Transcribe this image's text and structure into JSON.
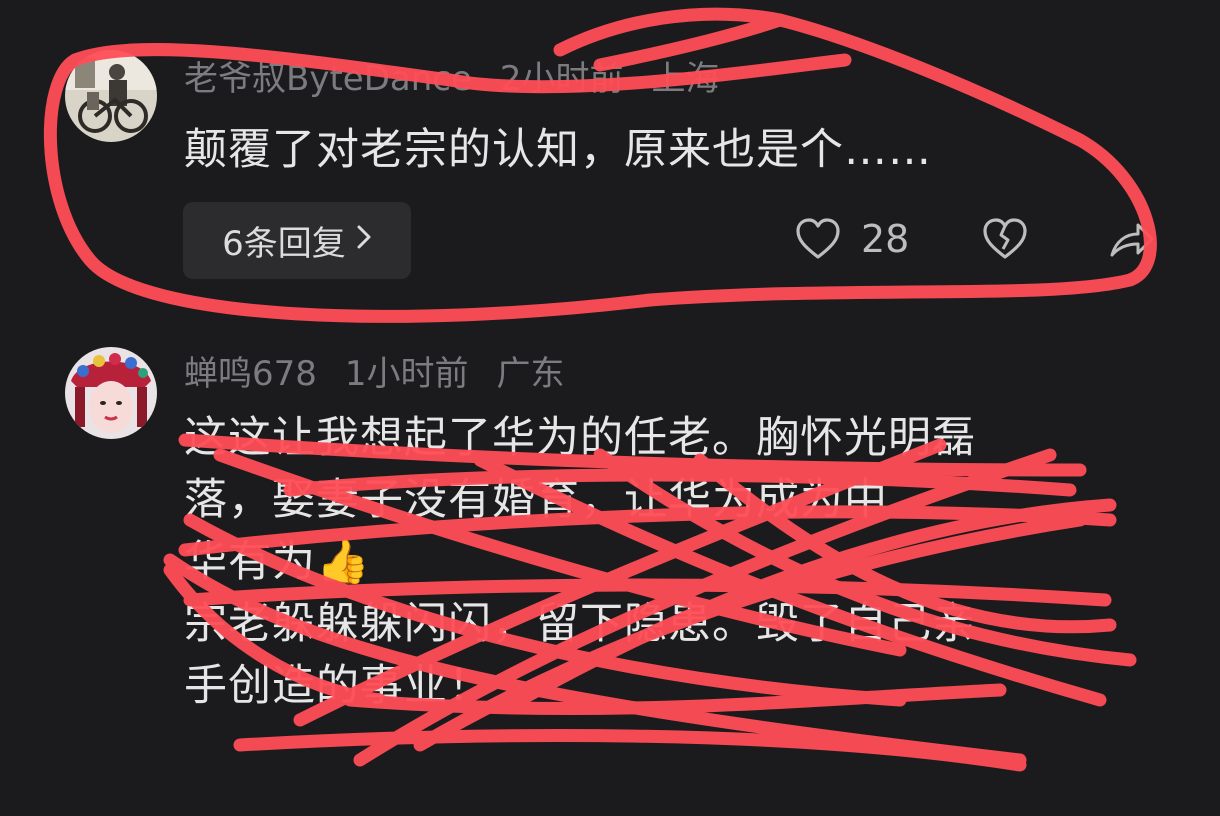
{
  "comments": [
    {
      "username": "老爷叔ByteDance",
      "time": "2小时前",
      "location": "上海",
      "text_lines": [
        "颠覆了对老宗的认知，原来也是个……"
      ],
      "reply_label": "6条回复",
      "like_count": "28"
    },
    {
      "username": "蝉鸣678",
      "time": "1小时前",
      "location": "广东",
      "text_lines": [
        "这这让我想起了华为的任老。胸怀光明磊",
        "落，娶妻子没有婚育，让华为成为中",
        "华有为👍",
        "宗老躲躲躲闪闪，留下隐患。毁了自己亲",
        "手创造的事业！"
      ]
    }
  ],
  "icons": {
    "like": "heart-outline-icon",
    "dislike": "broken-heart-icon",
    "share": "share-icon",
    "reply_chevron": "chevron-right-icon"
  },
  "colors": {
    "background": "#1b1b1d",
    "scribble": "#ff4d57",
    "meta_text": "#7c7c80",
    "body_text": "#e6e6e6"
  }
}
